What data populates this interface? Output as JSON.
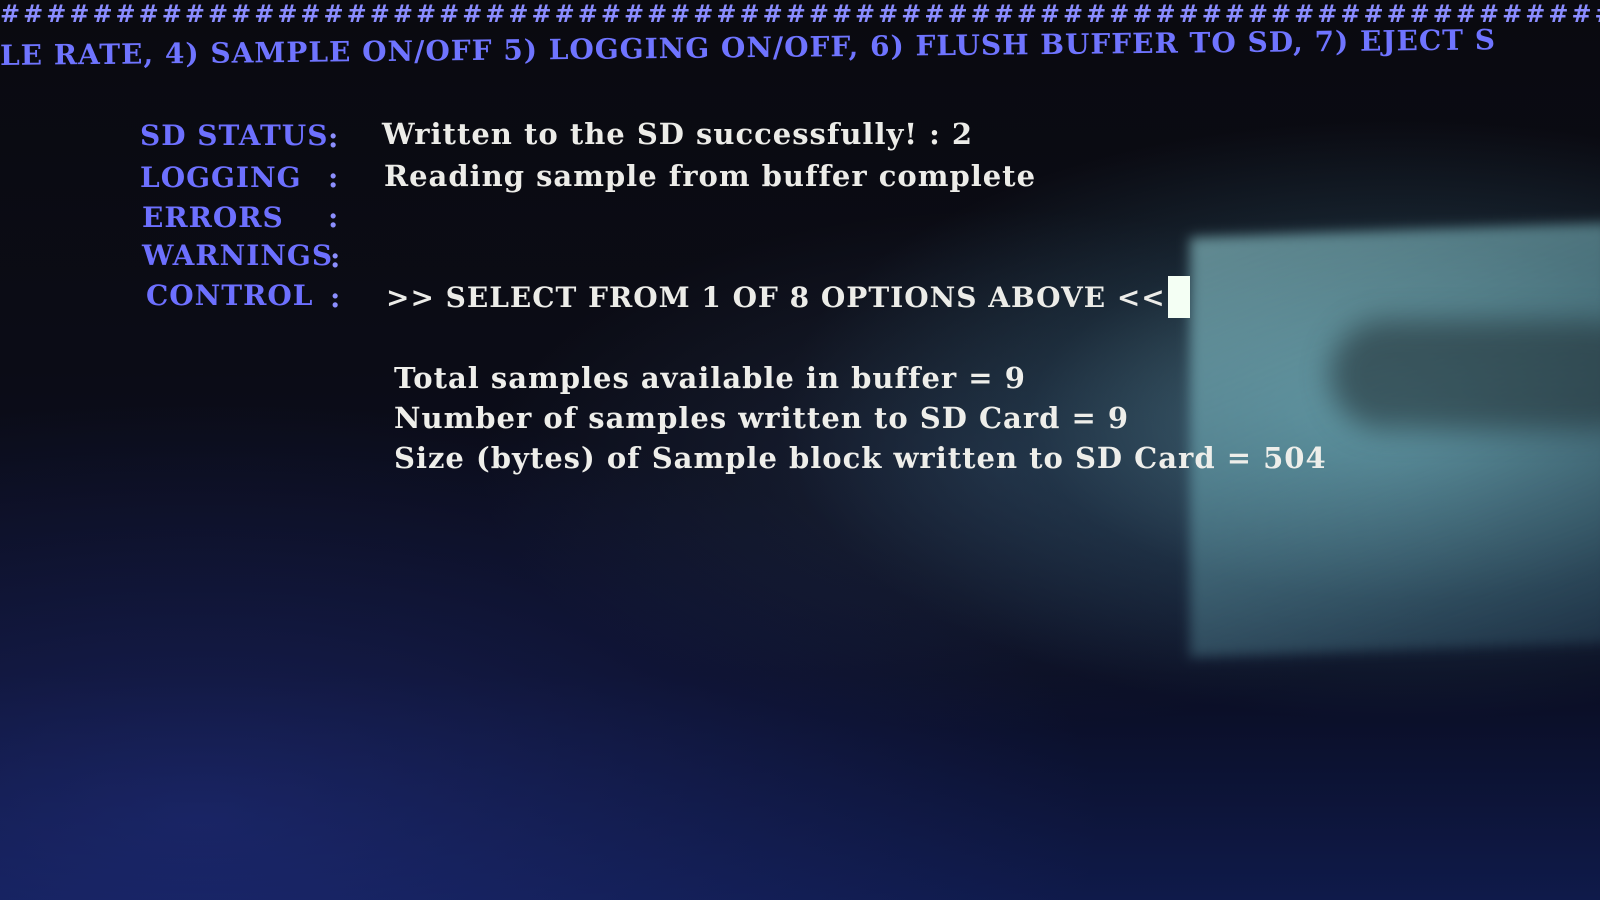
{
  "header": {
    "border": "################################################################################################################",
    "menu": "LE RATE, 4) SAMPLE ON/OFF 5) LOGGING ON/OFF, 6) FLUSH BUFFER TO SD, 7) EJECT S"
  },
  "status": {
    "sd_status": {
      "label": "SD STATUS",
      "sep": ":",
      "value": "Written to the SD successfully! : 2"
    },
    "logging": {
      "label": "LOGGING",
      "sep": ":",
      "value": "Reading sample from buffer complete"
    },
    "errors": {
      "label": "ERRORS",
      "sep": ":",
      "value": ""
    },
    "warnings": {
      "label": "WARNINGS",
      "sep": ":",
      "value": ""
    },
    "control": {
      "label": "CONTROL",
      "sep": ":",
      "value": ">> SELECT FROM 1 OF 8 OPTIONS ABOVE <<"
    }
  },
  "stats": {
    "total": "Total samples available in buffer = 9",
    "written": "Number of samples written to SD Card = 9",
    "size": "Size (bytes) of Sample block written to SD Card = 504"
  },
  "colors": {
    "label": "#6d70ff",
    "value": "#ecece8",
    "cursor": "#f4fff4"
  }
}
